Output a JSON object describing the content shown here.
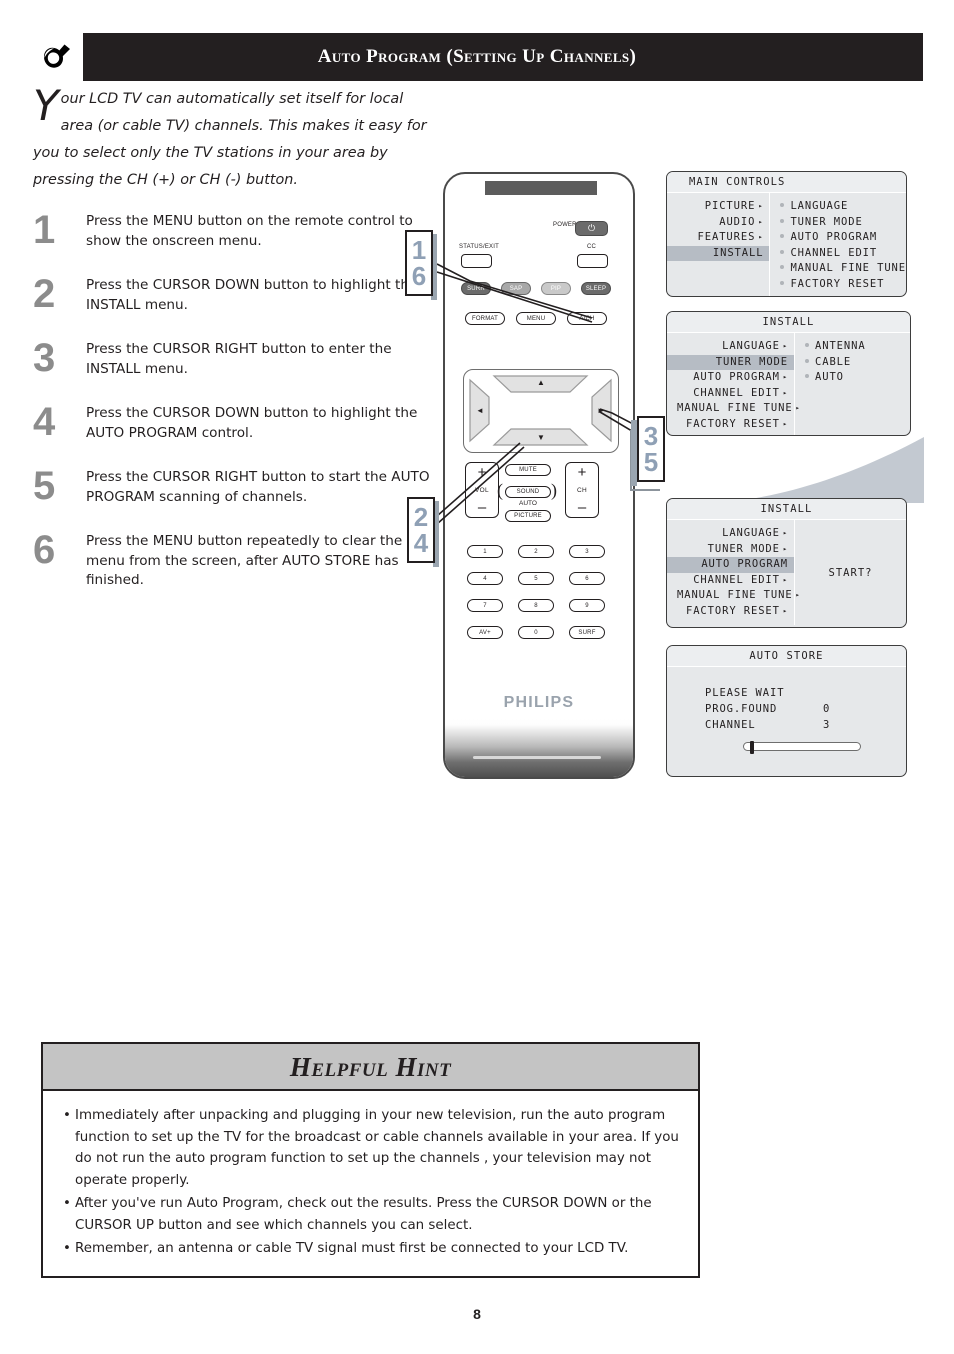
{
  "header": {
    "icon": "wrench-tool-icon",
    "title": "Auto Program (Setting Up Channels)"
  },
  "intro": {
    "dropcap": "Y",
    "text": "our LCD TV can automatically set itself for local area (or cable TV) channels. This makes it easy for you to select only the TV stations in your area by pressing the CH (+) or CH (-) button."
  },
  "steps": [
    {
      "num": "1",
      "text": "Press the MENU button on the remote control to show the onscreen menu."
    },
    {
      "num": "2",
      "text": "Press the CURSOR DOWN button to highlight the INSTALL menu."
    },
    {
      "num": "3",
      "text": "Press the CURSOR RIGHT button to enter the INSTALL menu."
    },
    {
      "num": "4",
      "text": "Press the CURSOR DOWN button to highlight the AUTO PROGRAM control."
    },
    {
      "num": "5",
      "text": "Press the CURSOR RIGHT button to start the AUTO PROGRAM scanning of channels."
    },
    {
      "num": "6",
      "text": "Press the MENU button repeatedly to clear the menu from the screen, after AUTO STORE has finished."
    }
  ],
  "callouts": {
    "menu_button": {
      "top": "1",
      "bottom": "6"
    },
    "cursor_down": {
      "top": "2",
      "bottom": "4"
    },
    "cursor_right": {
      "top": "3",
      "bottom": "5"
    }
  },
  "remote": {
    "brand": "PHILIPS",
    "power_label": "POWER",
    "power_glyph": "⏻",
    "status_exit_label": "STATUS/EXIT",
    "cc_label": "CC",
    "row_surr": "SURR",
    "row_sap": "SAP",
    "row_pip": "PIP",
    "row_sleep": "SLEEP",
    "format": "FORMAT",
    "menu": "MENU",
    "ach": "A/CH",
    "arrow_up": "▲",
    "arrow_down": "▼",
    "arrow_left": "◄",
    "arrow_right": "►",
    "mute": "MUTE",
    "sound": "SOUND",
    "auto": "AUTO",
    "picture": "PICTURE",
    "vol_label": "VOL",
    "ch_label": "CH",
    "plus": "+",
    "minus": "–",
    "keys": [
      "1",
      "2",
      "3",
      "4",
      "5",
      "6",
      "7",
      "8",
      "9"
    ],
    "av_plus": "AV+",
    "zero": "0",
    "surf": "SURF"
  },
  "osd": {
    "main_controls": {
      "title": "MAIN CONTROLS",
      "left_items": [
        {
          "label": "PICTURE",
          "arrow": true,
          "highlighted": false
        },
        {
          "label": "AUDIO",
          "arrow": true,
          "highlighted": false
        },
        {
          "label": "FEATURES",
          "arrow": true,
          "highlighted": false
        },
        {
          "label": "INSTALL",
          "arrow": false,
          "highlighted": true
        }
      ],
      "right_items": [
        "LANGUAGE",
        "TUNER MODE",
        "AUTO PROGRAM",
        "CHANNEL EDIT",
        "MANUAL FINE TUNE",
        "FACTORY RESET"
      ]
    },
    "install_tuner": {
      "title": "INSTALL",
      "left_items": [
        {
          "label": "LANGUAGE",
          "arrow": true,
          "highlighted": false
        },
        {
          "label": "TUNER MODE",
          "arrow": false,
          "highlighted": true
        },
        {
          "label": "AUTO PROGRAM",
          "arrow": true,
          "highlighted": false
        },
        {
          "label": "CHANNEL EDIT",
          "arrow": true,
          "highlighted": false
        },
        {
          "label": "MANUAL FINE TUNE",
          "arrow": true,
          "highlighted": false
        },
        {
          "label": "FACTORY RESET",
          "arrow": true,
          "highlighted": false
        }
      ],
      "right_items": [
        "ANTENNA",
        "CABLE",
        "AUTO"
      ]
    },
    "install_autoprogram": {
      "title": "INSTALL",
      "left_items": [
        {
          "label": "LANGUAGE",
          "arrow": true,
          "highlighted": false
        },
        {
          "label": "TUNER MODE",
          "arrow": true,
          "highlighted": false
        },
        {
          "label": "AUTO PROGRAM",
          "arrow": false,
          "highlighted": true
        },
        {
          "label": "CHANNEL EDIT",
          "arrow": true,
          "highlighted": false
        },
        {
          "label": "MANUAL FINE TUNE",
          "arrow": true,
          "highlighted": false
        },
        {
          "label": "FACTORY RESET",
          "arrow": true,
          "highlighted": false
        }
      ],
      "center_text": "START?"
    },
    "auto_store": {
      "title": "AUTO STORE",
      "status": "PLEASE WAIT",
      "rows": [
        {
          "label": "PROG.FOUND",
          "value": "0"
        },
        {
          "label": "CHANNEL",
          "value": "3"
        }
      ],
      "progress_percent": 4
    }
  },
  "hint": {
    "title": "Helpful Hint",
    "bullets": [
      "Immediately after unpacking and plugging in your new television, run the auto program function to set up the TV for the broadcast or cable channels available in your area. If you do not run the auto program function to set up the channels , your television may not operate properly.",
      "After you've run Auto Program, check out  the results. Press the CURSOR DOWN",
      "Remember, an antenna or cable TV signal must first be connected to your LCD TV."
    ],
    "bullet2_continuation": "or the CURSOR UP button and see which channels you can select."
  },
  "page_number": "8",
  "colors": {
    "header_bg": "#231f20",
    "step_number": "#8c8c8c",
    "callout_number": "#8fa0b5",
    "osd_bg": "#e6e8ea",
    "osd_highlight": "#b6bcc4",
    "hint_title_bg": "#c4c4c4"
  }
}
